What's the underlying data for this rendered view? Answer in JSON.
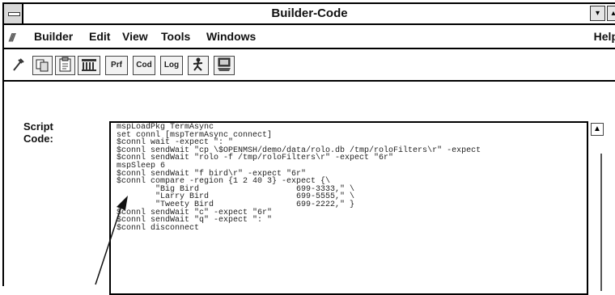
{
  "window": {
    "title": "Builder-Code",
    "min_glyph": "▾",
    "max_glyph": "▴"
  },
  "menubar": {
    "items": [
      {
        "label": "Builder"
      },
      {
        "label": "Edit"
      },
      {
        "label": "View"
      },
      {
        "label": "Tools"
      },
      {
        "label": "Windows"
      }
    ],
    "help": "Help"
  },
  "toolbar": {
    "buttons": [
      {
        "label": "",
        "icon": "wrench-icon"
      },
      {
        "label": "",
        "icon": "copy-icon"
      },
      {
        "label": "",
        "icon": "paste-icon"
      },
      {
        "label": "",
        "icon": "library-icon"
      },
      {
        "label": "Prf",
        "icon": ""
      },
      {
        "label": "Cod",
        "icon": ""
      },
      {
        "label": "Log",
        "icon": ""
      },
      {
        "label": "",
        "icon": "run-figure-icon"
      },
      {
        "label": "",
        "icon": "terminal-icon"
      }
    ]
  },
  "script": {
    "label_line1": "Script",
    "label_line2": "Code:",
    "code": "mspLoadPkg TermAsync\nset connl [mspTermAsync connect]\n$connl wait -expect \": \"\n$connl sendWait \"cp \\$OPENMSH/demo/data/rolo.db /tmp/roloFilters\\r\" -expect\n$connl sendWait \"rolo -f /tmp/roloFilters\\r\" -expect \"6r\"\nmspSleep 6\n$connl sendWait \"f bird\\r\" -expect \"6r\"\n$connl compare -region {1 2 40 3} -expect {\\\n        \"Big Bird                    699-3333,\" \\\n        \"Larry Bird                  699-5555,\" \\\n        \"Tweety Bird                 699-2222,\" }\n$connl sendWait \"c\" -expect \"6r\"\n$connl sendWait \"q\" -expect \": \"\n$connl disconnect"
  }
}
